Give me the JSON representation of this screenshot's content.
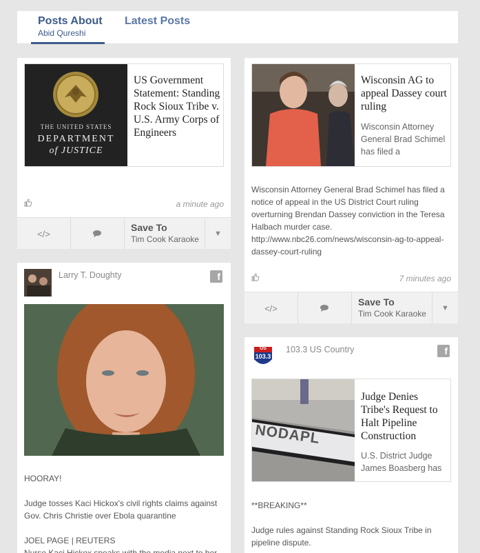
{
  "tabs": {
    "posts_about": "Posts About",
    "person": "Abid Qureshi",
    "latest": "Latest Posts"
  },
  "cards": {
    "c1": {
      "org_line1": "THE UNITED STATES",
      "org_line2": "DEPARTMENT",
      "org_line3": "of JUSTICE",
      "title": "US Government Statement: Standing Rock Sioux Tribe v. U.S. Army Corps of Engineers",
      "time": "a minute ago",
      "save_label": "Save To",
      "save_target": "Tim Cook Karaoke"
    },
    "c2": {
      "title": "Wisconsin AG to appeal Dassey court ruling",
      "desc": "Wisconsin Attorney General Brad Schimel has filed a",
      "body": "Wisconsin Attorney General Brad Schimel has filed a notice of appeal in the US District Court ruling overturning Brendan Dassey conviction in the Teresa Halbach murder case. http://www.nbc26.com/news/wisconsin-ag-to-appeal-dassey-court-ruling",
      "time": "7 minutes ago",
      "save_label": "Save To",
      "save_target": "Tim Cook Karaoke"
    },
    "c3": {
      "author": "Larry T. Doughty",
      "p1": "HOORAY!",
      "p2": "Judge tosses Kaci Hickox's civil rights claims against Gov. Chris Christie over Ebola quarantine",
      "p3": "JOEL PAGE | REUTERS",
      "p4": "Nurse Kaci Hickox speaks with the media next to her"
    },
    "c4": {
      "author": "103.3 US Country",
      "logo_top": "US",
      "logo_num": "103.3",
      "sign_text": "NODAPL",
      "title": "Judge Denies Tribe's Request to Halt Pipeline Construction",
      "desc": "U.S. District Judge James Boasberg has",
      "p1": "**BREAKING**",
      "p2": "Judge rules against Standing Rock Sioux Tribe in pipeline dispute."
    }
  },
  "colors": {
    "accent": "#3d5a8a",
    "background": "#e6e6e6"
  }
}
